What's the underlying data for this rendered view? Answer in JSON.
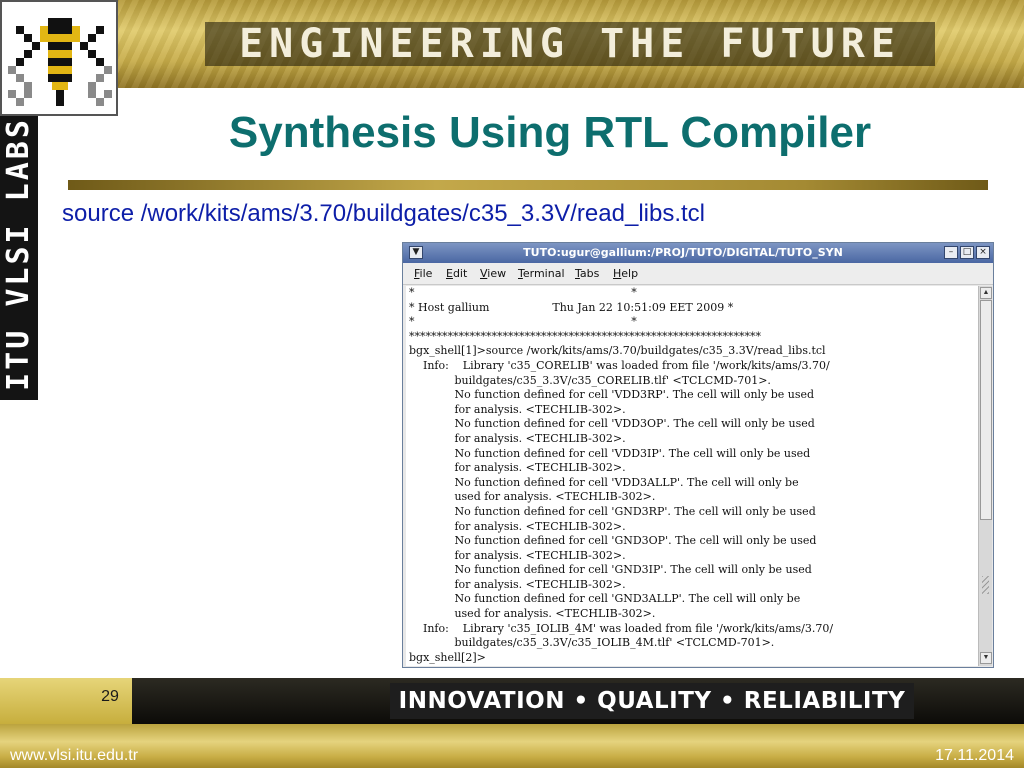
{
  "banner": {
    "title": "ENGINEERING THE FUTURE",
    "side_label": "ITU VLSI LABS"
  },
  "slide": {
    "title": "Synthesis Using RTL Compiler",
    "source_line": "source /work/kits/ams/3.70/buildgates/c35_3.3V/read_libs.tcl"
  },
  "terminal": {
    "window_title": "TUTO:ugur@gallium:/PROJ/TUTO/DIGITAL/TUTO_SYN",
    "window_buttons": [
      "minimize-icon",
      "maximize-icon",
      "close-icon"
    ],
    "menu": [
      "File",
      "Edit",
      "View",
      "Terminal",
      "Tabs",
      "Help"
    ],
    "lines": [
      "*                                                              *",
      "* Host gallium                  Thu Jan 22 10:51:09 EET 2009 *",
      "*                                                              *",
      "****************************************************************",
      "bgx_shell[1]>source /work/kits/ams/3.70/buildgates/c35_3.3V/read_libs.tcl",
      "    Info:    Library 'c35_CORELIB' was loaded from file '/work/kits/ams/3.70/",
      "             buildgates/c35_3.3V/c35_CORELIB.tlf' <TCLCMD-701>.",
      "             No function defined for cell 'VDD3RP'. The cell will only be used",
      "             for analysis. <TECHLIB-302>.",
      "             No function defined for cell 'VDD3OP'. The cell will only be used",
      "             for analysis. <TECHLIB-302>.",
      "             No function defined for cell 'VDD3IP'. The cell will only be used",
      "             for analysis. <TECHLIB-302>.",
      "             No function defined for cell 'VDD3ALLP'. The cell will only be",
      "             used for analysis. <TECHLIB-302>.",
      "             No function defined for cell 'GND3RP'. The cell will only be used",
      "             for analysis. <TECHLIB-302>.",
      "             No function defined for cell 'GND3OP'. The cell will only be used",
      "             for analysis. <TECHLIB-302>.",
      "             No function defined for cell 'GND3IP'. The cell will only be used",
      "             for analysis. <TECHLIB-302>.",
      "             No function defined for cell 'GND3ALLP'. The cell will only be",
      "             used for analysis. <TECHLIB-302>.",
      "    Info:    Library 'c35_IOLIB_4M' was loaded from file '/work/kits/ams/3.70/",
      "             buildgates/c35_3.3V/c35_IOLIB_4M.tlf' <TCLCMD-701>.",
      "bgx_shell[2]>"
    ]
  },
  "footer": {
    "page_number": "29",
    "tagline": "INNOVATION • QUALITY • RELIABILITY",
    "url": "www.vlsi.itu.edu.tr",
    "date": "17.11.2014"
  },
  "colors": {
    "title": "#0d6e6e",
    "source_line": "#0d1ea8",
    "gold": "#c6ab48",
    "terminal_titlebar": "#4a67a3"
  }
}
